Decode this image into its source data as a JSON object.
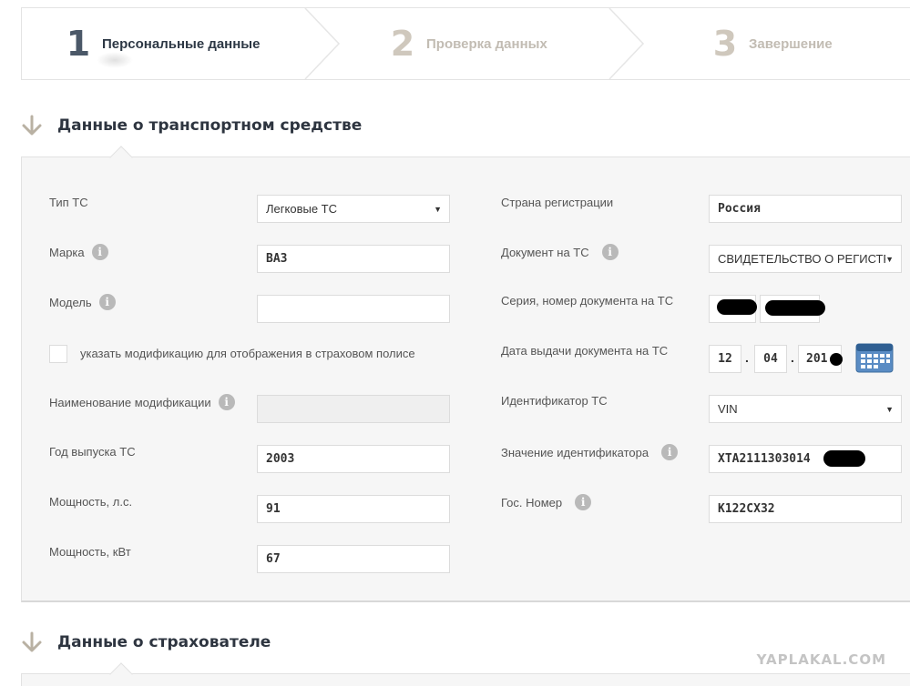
{
  "steps": [
    {
      "number": "1",
      "label": "Персональные данные",
      "active": true
    },
    {
      "number": "2",
      "label": "Проверка данных",
      "active": false
    },
    {
      "number": "3",
      "label": "Завершение",
      "active": false
    }
  ],
  "vehicle_section": {
    "title": "Данные о транспортном средстве",
    "left": {
      "type_label": "Тип ТС",
      "type_value": "Легковые ТС",
      "make_label": "Марка",
      "make_value": "ВАЗ",
      "model_label": "Модель",
      "model_value": "",
      "modification_checkbox_label": "указать модификацию для отображения в страховом полисе",
      "modification_name_label": "Наименование модификации",
      "modification_name_value": "",
      "year_label": "Год выпуска ТС",
      "year_value": "2003",
      "power_hp_label": "Мощность, л.с.",
      "power_hp_value": "91",
      "power_kw_label": "Мощность, кВт",
      "power_kw_value": "67"
    },
    "right": {
      "country_label": "Страна регистрации",
      "country_value": "Россия",
      "document_label": "Документ на ТС",
      "document_value": "СВИДЕТЕЛЬСТВО О РЕГИСТР",
      "doc_series_label": "Серия, номер документа на ТС",
      "doc_date_label": "Дата выдачи документа на ТС",
      "doc_date_day": "12",
      "doc_date_month": "04",
      "doc_date_year": "201",
      "identifier_label": "Идентификатор ТС",
      "identifier_value": "VIN",
      "identifier_value_label": "Значение идентификатора",
      "identifier_value_value": "XTA2111303014",
      "plate_label": "Гос. Номер",
      "plate_value": "К122СХ32"
    }
  },
  "insurer_section": {
    "title": "Данные о страхователе"
  },
  "watermark": "YAPLAKAL.COM",
  "icons": {
    "info": "i",
    "caret": "▼"
  },
  "colors": {
    "active_step": "#2d3845",
    "inactive_step": "#c2bcb3",
    "panel_bg": "#f6f6f6",
    "calendar_blue": "#4a7fb5"
  }
}
